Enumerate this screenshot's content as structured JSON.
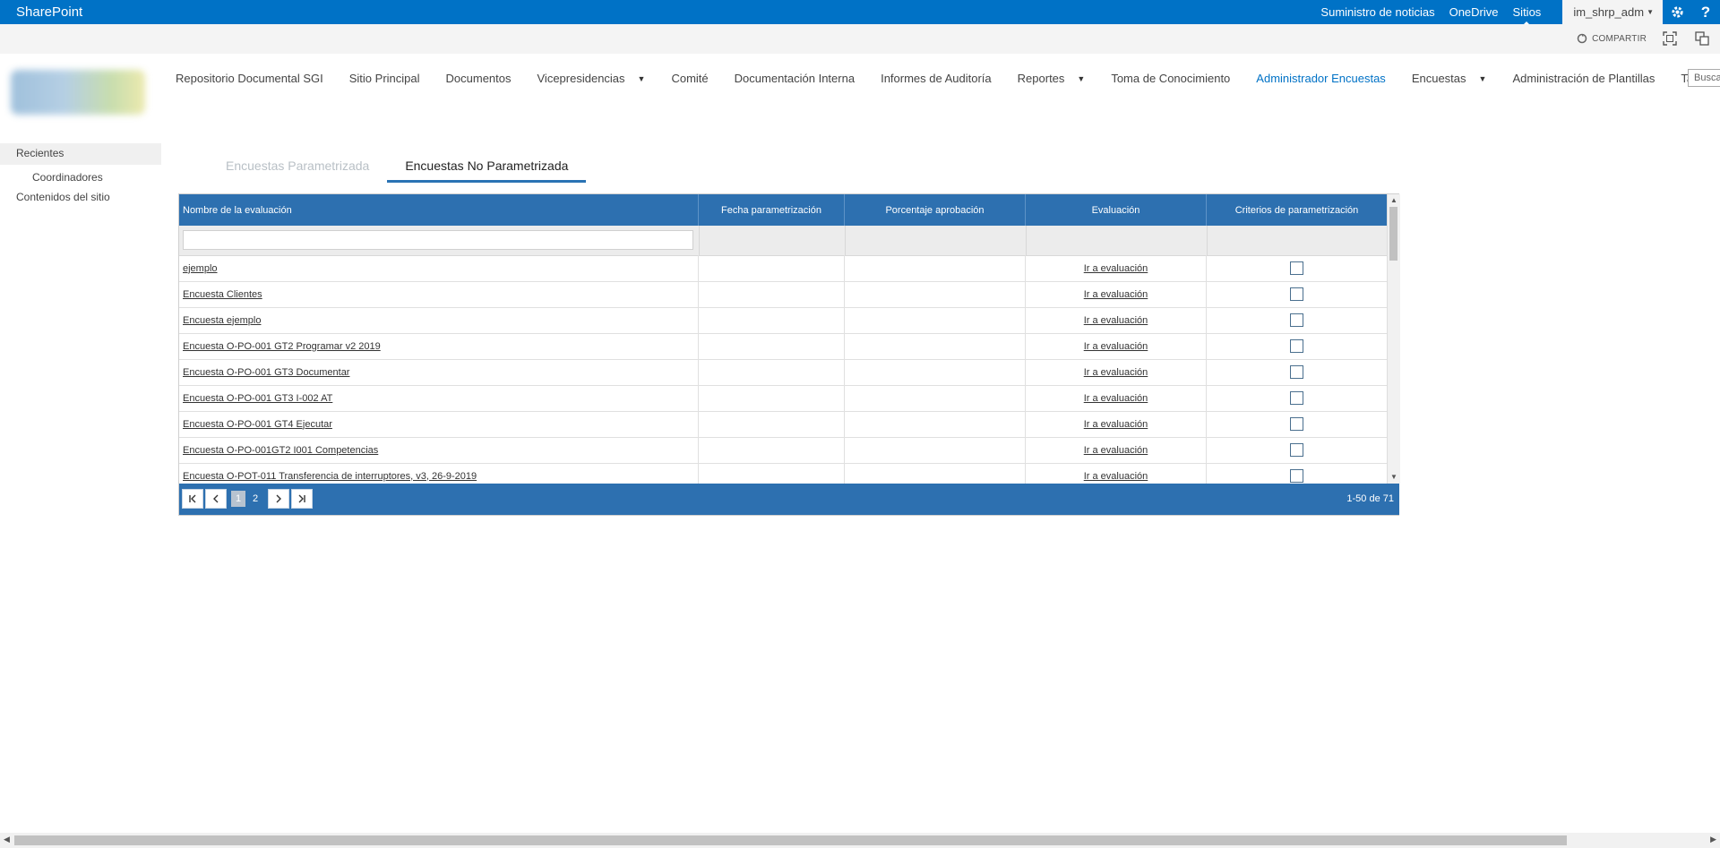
{
  "suite": {
    "brand": "SharePoint",
    "links": [
      "Suministro de noticias",
      "OneDrive",
      "Sitios"
    ],
    "user": "im_shrp_adm",
    "settings_icon": "gear-icon",
    "help_icon": "?"
  },
  "ribbon": {
    "share_label": "COMPARTIR"
  },
  "topnav": {
    "items": [
      {
        "label": "Repositorio Documental SGI"
      },
      {
        "label": "Sitio Principal"
      },
      {
        "label": "Documentos"
      },
      {
        "label": "Vicepresidencias",
        "dropdown": true
      },
      {
        "label": "Comité"
      },
      {
        "label": "Documentación Interna"
      },
      {
        "label": "Informes de Auditoría"
      },
      {
        "label": "Reportes",
        "dropdown": true
      },
      {
        "label": "Toma de Conocimiento"
      },
      {
        "label": "Administrador Encuestas",
        "selected": true
      },
      {
        "label": "Encuestas",
        "dropdown": true
      },
      {
        "label": "Administración de Plantillas"
      },
      {
        "label": "Tabla de permisos"
      }
    ],
    "search_placeholder": "Buscar"
  },
  "leftnav": {
    "recent": "Recientes",
    "coordinators": "Coordinadores",
    "site_contents": "Contenidos del sitio"
  },
  "tabs": [
    {
      "label": "Encuestas Parametrizada",
      "active": false
    },
    {
      "label": "Encuestas No Parametrizada",
      "active": true
    }
  ],
  "grid": {
    "columns": [
      "Nombre de la evaluación",
      "Fecha parametrización",
      "Porcentaje aprobación",
      "Evaluación",
      "Criterios de parametrización"
    ],
    "rows": [
      {
        "name": "ejemplo",
        "fecha": "",
        "porcentaje": "",
        "evaluacion": "Ir a evaluación",
        "checked": false
      },
      {
        "name": "Encuesta Clientes",
        "fecha": "",
        "porcentaje": "",
        "evaluacion": "Ir a evaluación",
        "checked": false
      },
      {
        "name": "Encuesta ejemplo",
        "fecha": "",
        "porcentaje": "",
        "evaluacion": "Ir a evaluación",
        "checked": false
      },
      {
        "name": "Encuesta O-PO-001 GT2 Programar v2 2019",
        "fecha": "",
        "porcentaje": "",
        "evaluacion": "Ir a evaluación",
        "checked": false
      },
      {
        "name": "Encuesta O-PO-001 GT3 Documentar",
        "fecha": "",
        "porcentaje": "",
        "evaluacion": "Ir a evaluación",
        "checked": false
      },
      {
        "name": "Encuesta O-PO-001 GT3 I-002 AT",
        "fecha": "",
        "porcentaje": "",
        "evaluacion": "Ir a evaluación",
        "checked": false
      },
      {
        "name": "Encuesta O-PO-001 GT4 Ejecutar",
        "fecha": "",
        "porcentaje": "",
        "evaluacion": "Ir a evaluación",
        "checked": false
      },
      {
        "name": "Encuesta O-PO-001GT2 I001 Competencias",
        "fecha": "",
        "porcentaje": "",
        "evaluacion": "Ir a evaluación",
        "checked": false
      },
      {
        "name": "Encuesta O-POT-011 Transferencia de interruptores, v3, 26-9-2019",
        "fecha": "",
        "porcentaje": "",
        "evaluacion": "Ir a evaluación",
        "checked": false
      }
    ],
    "pager": {
      "pages": [
        "1",
        "2"
      ],
      "current_page": "1",
      "info": "1-50 de 71"
    }
  }
}
